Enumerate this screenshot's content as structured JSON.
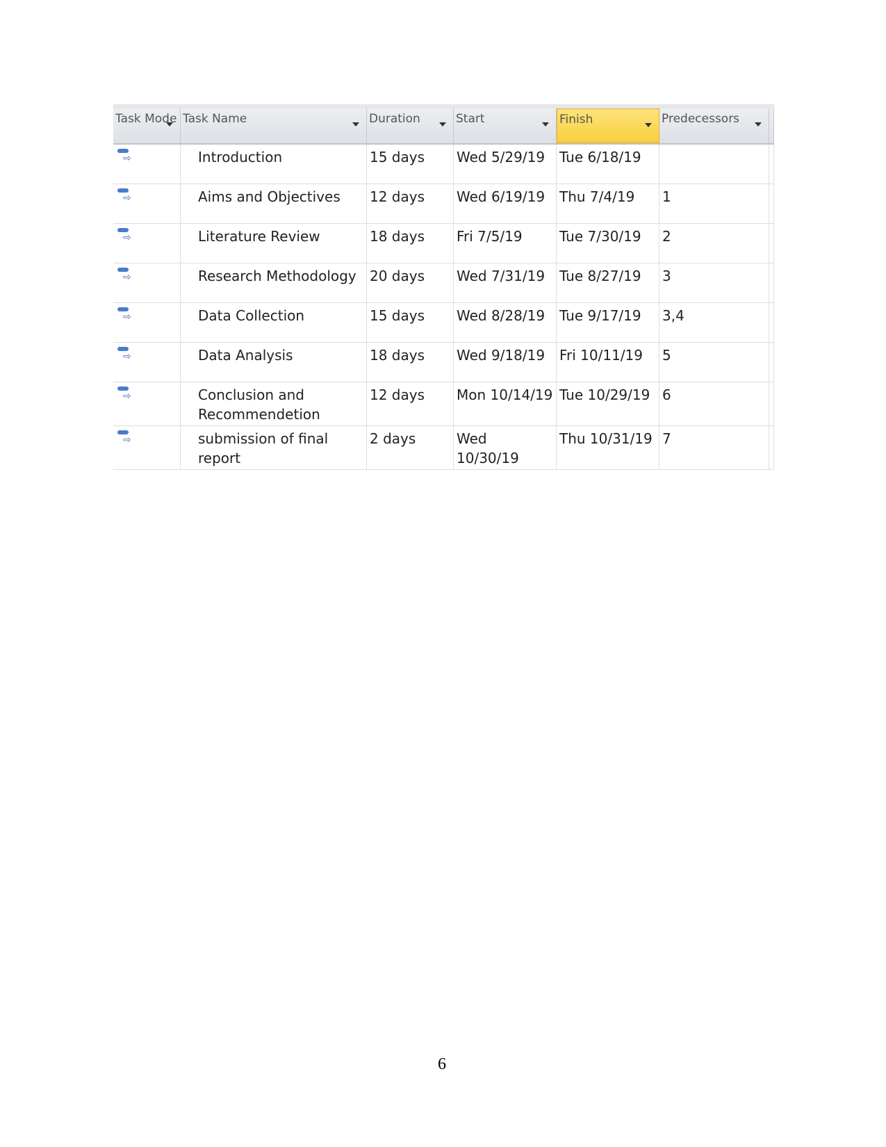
{
  "table": {
    "headers": [
      "Task Mode",
      "Task Name",
      "Duration",
      "Start",
      "Finish",
      "Predecessors"
    ],
    "selected_header": "Finish",
    "accent": "#f9cf3c",
    "rows": [
      {
        "name": "Introduction",
        "duration": "15 days",
        "start": "Wed 5/29/19",
        "finish": "Tue 6/18/19",
        "pred": ""
      },
      {
        "name": "Aims and Objectives",
        "duration": "12 days",
        "start": "Wed 6/19/19",
        "finish": "Thu 7/4/19",
        "pred": "1"
      },
      {
        "name": "Literature Review",
        "duration": "18 days",
        "start": "Fri 7/5/19",
        "finish": "Tue 7/30/19",
        "pred": "2"
      },
      {
        "name": "Research Methodology",
        "duration": "20 days",
        "start": "Wed 7/31/19",
        "finish": "Tue 8/27/19",
        "pred": "3"
      },
      {
        "name": "Data Collection",
        "duration": "15 days",
        "start": "Wed 8/28/19",
        "finish": "Tue 9/17/19",
        "pred": "3,4"
      },
      {
        "name": "Data Analysis",
        "duration": "18 days",
        "start": "Wed 9/18/19",
        "finish": "Fri 10/11/19",
        "pred": "5"
      },
      {
        "name": "Conclusion and Recommendetion",
        "duration": "12 days",
        "start": "Mon 10/14/19",
        "finish": "Tue 10/29/19",
        "pred": "6"
      },
      {
        "name": "submission of final report",
        "duration": "2 days",
        "start": "Wed 10/30/19",
        "finish": "Thu 10/31/19",
        "pred": "7"
      }
    ],
    "task_mode_icon": "auto-scheduled-task-icon"
  },
  "page_number": "6"
}
